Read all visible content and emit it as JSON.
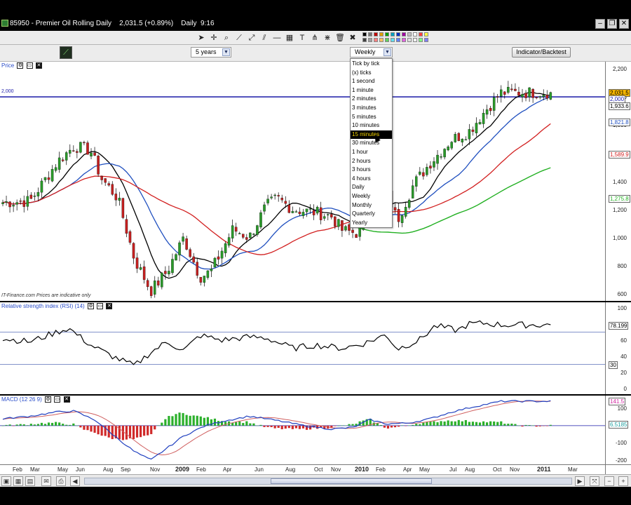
{
  "window": {
    "title": "85950 - Premier Oil Rolling Daily    2,031.5 (+0.89%)    Daily  9:16"
  },
  "toolbar2": {
    "range_value": "5 years",
    "interval_value": "Weekly",
    "indicator_button": "Indicator/Backtest"
  },
  "interval_options": [
    "Tick by tick",
    "(x) ticks",
    "1 second",
    "1 minute",
    "2 minutes",
    "3 minutes",
    "5 minutes",
    "10 minutes",
    "15 minutes",
    "30 minutes",
    "1 hour",
    "2 hours",
    "3 hours",
    "4 hours",
    "Daily",
    "Weekly",
    "Monthly",
    "Quarterly",
    "Yearly"
  ],
  "interval_highlighted": "15 minutes",
  "price_panel": {
    "title": "Price",
    "hline_label": "2,000",
    "footer": "IT-Finance.com  Prices are indicative only",
    "ticks": [
      "2,200",
      "2,000",
      "1,800",
      "1,600",
      "1,400",
      "1,200",
      "1,000",
      "800",
      "600"
    ],
    "value_boxes": [
      "2,031.5",
      "2,000",
      "1,933.6",
      "1,821.8",
      "1,589.9",
      "1,275.8"
    ],
    "colors": {
      "price_line": "#1a1aa8",
      "sma_fast": "#000000",
      "sma_mid": "#1f4fbf",
      "sma_slow": "#d22020",
      "sma_long": "#22b022",
      "bull": "#2a9a2a",
      "bear": "#c52020"
    }
  },
  "rsi_panel": {
    "title": "Relative strength index (RSI) (14)",
    "ticks": [
      "100",
      "80",
      "60",
      "40",
      "20",
      "0"
    ],
    "value_boxes": [
      "78.199",
      "30"
    ]
  },
  "macd_panel": {
    "title": "MACD (12 26 9)",
    "ticks": [
      "100",
      "0",
      "-100",
      "-200"
    ],
    "value_boxes": [
      "141.5",
      "6.5185"
    ]
  },
  "date_axis": {
    "labels": [
      "Feb",
      "Mar",
      "May",
      "Jun",
      "Aug",
      "Sep",
      "Nov",
      "2009",
      "Feb",
      "Apr",
      "Jun",
      "Aug",
      "Oct",
      "Nov",
      "2010",
      "Feb",
      "Apr",
      "May",
      "Jul",
      "Aug",
      "Oct",
      "Nov",
      "2011",
      "Mar"
    ]
  },
  "chart_data": {
    "type": "candlestick",
    "title": "85950 - Premier Oil Rolling Daily",
    "interval": "Weekly",
    "ylim": [
      600,
      2200
    ],
    "last": 2031.5,
    "change_pct": 0.89,
    "horizontal_line": 2000,
    "series": [
      {
        "name": "Price",
        "anchors": [
          [
            0,
            1250
          ],
          [
            0.05,
            1260
          ],
          [
            0.1,
            1540
          ],
          [
            0.13,
            1650
          ],
          [
            0.16,
            1620
          ],
          [
            0.18,
            1420
          ],
          [
            0.21,
            1280
          ],
          [
            0.24,
            850
          ],
          [
            0.26,
            700
          ],
          [
            0.27,
            620
          ],
          [
            0.3,
            760
          ],
          [
            0.33,
            1000
          ],
          [
            0.36,
            720
          ],
          [
            0.38,
            760
          ],
          [
            0.42,
            1060
          ],
          [
            0.45,
            1000
          ],
          [
            0.48,
            1220
          ],
          [
            0.5,
            1280
          ],
          [
            0.53,
            1200
          ],
          [
            0.57,
            1180
          ],
          [
            0.6,
            1150
          ],
          [
            0.62,
            1050
          ],
          [
            0.65,
            1030
          ],
          [
            0.68,
            1300
          ],
          [
            0.7,
            1350
          ],
          [
            0.72,
            1120
          ],
          [
            0.75,
            1380
          ],
          [
            0.78,
            1530
          ],
          [
            0.82,
            1700
          ],
          [
            0.85,
            1750
          ],
          [
            0.88,
            1900
          ],
          [
            0.91,
            2031
          ]
        ]
      },
      {
        "name": "MA 1933.6",
        "last": 1933.6
      },
      {
        "name": "MA 1821.8",
        "last": 1821.8
      },
      {
        "name": "MA 1589.9",
        "last": 1589.9
      },
      {
        "name": "MA 1275.8",
        "last": 1275.8
      }
    ],
    "rsi": {
      "ylim": [
        0,
        100
      ],
      "last": 78.199,
      "levels": [
        70,
        30
      ],
      "anchors": [
        [
          0,
          62
        ],
        [
          0.05,
          58
        ],
        [
          0.09,
          68
        ],
        [
          0.12,
          75
        ],
        [
          0.16,
          54
        ],
        [
          0.2,
          40
        ],
        [
          0.24,
          28
        ],
        [
          0.27,
          45
        ],
        [
          0.3,
          58
        ],
        [
          0.33,
          47
        ],
        [
          0.36,
          66
        ],
        [
          0.4,
          60
        ],
        [
          0.45,
          64
        ],
        [
          0.48,
          63
        ],
        [
          0.53,
          50
        ],
        [
          0.57,
          54
        ],
        [
          0.62,
          50
        ],
        [
          0.66,
          56
        ],
        [
          0.7,
          67
        ],
        [
          0.72,
          49
        ],
        [
          0.76,
          60
        ],
        [
          0.79,
          78
        ],
        [
          0.83,
          72
        ],
        [
          0.85,
          80
        ],
        [
          0.88,
          81
        ],
        [
          0.91,
          79
        ]
      ]
    },
    "macd": {
      "ylim": [
        -200,
        150
      ],
      "last": 141.5,
      "signal": 6.5185,
      "anchors": [
        [
          0,
          40
        ],
        [
          0.05,
          55
        ],
        [
          0.1,
          80
        ],
        [
          0.13,
          85
        ],
        [
          0.17,
          30
        ],
        [
          0.2,
          -50
        ],
        [
          0.24,
          -150
        ],
        [
          0.27,
          -200
        ],
        [
          0.3,
          -130
        ],
        [
          0.33,
          -60
        ],
        [
          0.37,
          0
        ],
        [
          0.4,
          25
        ],
        [
          0.45,
          55
        ],
        [
          0.5,
          30
        ],
        [
          0.55,
          0
        ],
        [
          0.6,
          -20
        ],
        [
          0.64,
          -10
        ],
        [
          0.67,
          35
        ],
        [
          0.7,
          10
        ],
        [
          0.74,
          15
        ],
        [
          0.78,
          40
        ],
        [
          0.82,
          80
        ],
        [
          0.86,
          110
        ],
        [
          0.91,
          141.5
        ]
      ]
    }
  }
}
